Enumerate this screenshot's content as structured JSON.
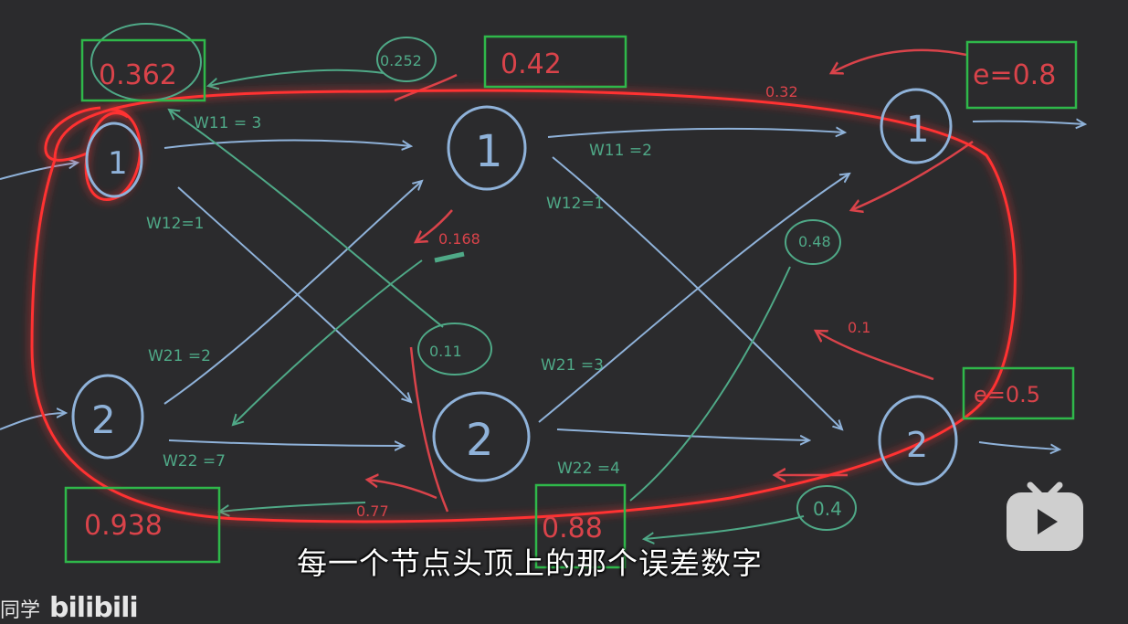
{
  "nodes": {
    "left_1": "1",
    "left_2": "2",
    "hidden_1": "1",
    "hidden_2": "2",
    "output_1": "1",
    "output_2": "2"
  },
  "weights": {
    "w11_left": "W11 = 3",
    "w12_left": "W12=1",
    "w21_left": "W21 =2",
    "w22_left": "W22 =7",
    "w11_right": "W11 =2",
    "w12_right": "W12=1",
    "w21_right": "W21 =3",
    "w22_right": "W22 =4"
  },
  "errors": {
    "input_1": "0.362",
    "input_2": "0.938",
    "hidden_1": "0.42",
    "hidden_2": "0.88",
    "output_1": "e=0.8",
    "output_2": "e=0.5"
  },
  "annotations": {
    "red_032": "0.32",
    "red_0168": "0.168",
    "red_01": "0.1",
    "red_077": "0.77",
    "green_0252": "0.252",
    "green_011": "0.11",
    "green_048": "0.48",
    "green_04": "0.4"
  },
  "subtitle": "每一个节点头顶上的那个误差数字",
  "watermark": {
    "prefix": "同学",
    "brand": "bilibili"
  },
  "colors": {
    "background": "#2b2b2d",
    "node_stroke": "#8fb2d9",
    "green_ink": "#4fa987",
    "red_ink": "#d9434a",
    "highlight_box": "#2fb84a",
    "glow_loop": "#ff2a2a"
  }
}
